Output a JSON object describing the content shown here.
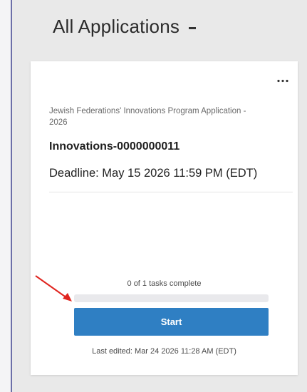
{
  "header": {
    "title": "All Applications",
    "dropdown_icon": "chevron-down-icon"
  },
  "card": {
    "menu_icon": "more-horizontal-icon",
    "program_name": "Jewish Federations' Innovations Program Application - 2026",
    "application_id": "Innovations-0000000011",
    "deadline": "Deadline: May 15 2026 11:59 PM (EDT)",
    "tasks_status": "0 of 1 tasks complete",
    "progress_fraction": 0,
    "start_label": "Start",
    "last_edited": "Last edited: Mar 24 2026 11:28 AM (EDT)"
  },
  "annotation": {
    "arrow_icon": "red-arrow-icon",
    "arrow_color": "#e0251f"
  },
  "colors": {
    "accent": "#2f7fc3",
    "background": "#e9e9e9",
    "card": "#ffffff"
  }
}
